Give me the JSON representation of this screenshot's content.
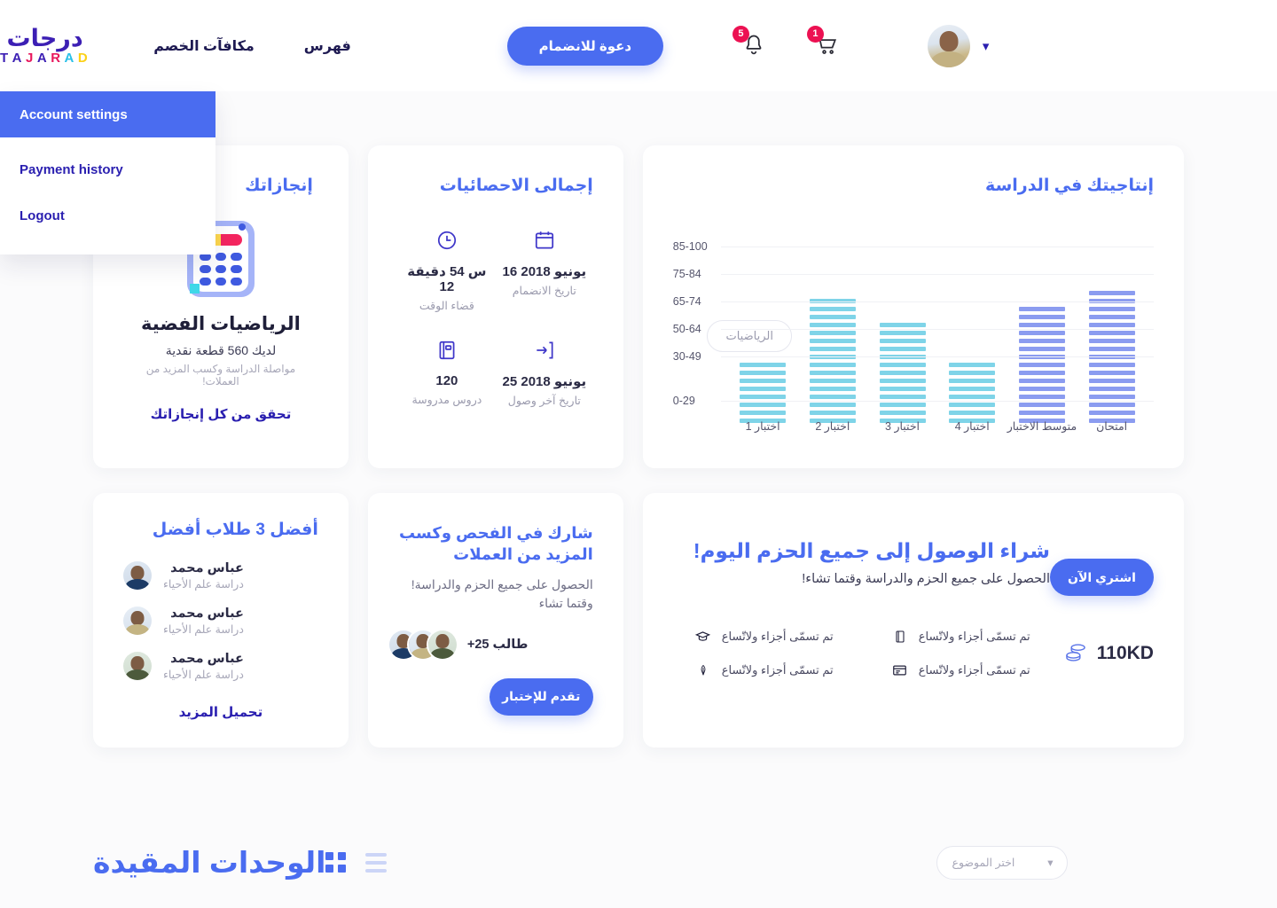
{
  "header": {
    "logo_ar": "درجات",
    "logo_latin": [
      "D",
      "A",
      "R",
      "A",
      "J",
      "A",
      "T"
    ],
    "nav": [
      {
        "label": "فهرس"
      },
      {
        "label": "مكافآت الخصم"
      }
    ],
    "cta_label": "دعوة للانضمام",
    "notifications_count": "5",
    "cart_count": "1"
  },
  "dropdown": {
    "items": [
      {
        "label": "Account settings",
        "active": true
      },
      {
        "label": "Payment history",
        "active": false
      },
      {
        "label": "Logout",
        "active": false
      }
    ]
  },
  "achievements": {
    "title": "إنجازاتك",
    "badge_name": "الرياضيات الفضية",
    "coins_text": "لديك 560 قطعة نقدية",
    "hint": "مواصلة الدراسة وكسب المزيد من العملات!",
    "link": "تحقق من كل إنجازاتك"
  },
  "stats": {
    "title": "إجمالى الاحصائيات",
    "items": [
      {
        "icon": "calendar-icon",
        "value": "يونيو 2018 16",
        "label": "تاريخ الانضمام"
      },
      {
        "icon": "clock-icon",
        "value": "س 54 دقيقة 12",
        "label": "قضاء الوقت"
      },
      {
        "icon": "login-arrow-icon",
        "value": "يونيو 2018 25",
        "label": "تاريخ آخر وصول"
      },
      {
        "icon": "book-icon",
        "value": "120",
        "label": "دروس مدروسة"
      }
    ]
  },
  "chart_card": {
    "title": "إنتاجيتك في الدراسة",
    "filter_chip": "الرياضيات"
  },
  "chart_data": {
    "type": "bar",
    "title": "إنتاجيتك في الدراسة",
    "categories": [
      "اختبار 1",
      "اختبار 2",
      "اختبار 3",
      "اختبار 4",
      "متوسط الاختبار",
      "امتحان"
    ],
    "values": [
      35,
      72,
      58,
      37,
      70,
      78
    ],
    "colors": [
      "#7fd4e8",
      "#7fd4e8",
      "#7fd4e8",
      "#7fd4e8",
      "#8b9cf0",
      "#8b9cf0"
    ],
    "ytick_labels": [
      "0-29",
      "30-49",
      "50-64",
      "65-74",
      "75-84",
      "85-100"
    ],
    "ytick_positions": [
      8,
      41,
      61,
      81,
      101,
      121
    ],
    "ylim": [
      0,
      100
    ],
    "xlabel": "",
    "ylabel": "",
    "grid": true,
    "legend": "none",
    "style": "striped-bars"
  },
  "top_students": {
    "title": "أفضل 3 طلاب أفضل",
    "students": [
      {
        "name": "عباس محمد",
        "desc": "دراسة علم الأحياء"
      },
      {
        "name": "عباس محمد",
        "desc": "دراسة علم الأحياء"
      },
      {
        "name": "عباس محمد",
        "desc": "دراسة علم الأحياء"
      }
    ],
    "link": "تحميل المزيد"
  },
  "exam_promo": {
    "title": "شارك في الفحص وكسب المزيد من العملات",
    "subtitle": "الحصول على جميع الحزم والدراسة! وقتما تشاء",
    "students_count": "طالب 25+",
    "button": "تقدم للإختبار"
  },
  "buy_card": {
    "title": "شراء الوصول إلى جميع الحزم اليوم!",
    "subtitle": "الحصول على جميع الحزم والدراسة وقتما تشاء!",
    "button": "اشتري الآن",
    "price": "110KD",
    "features": [
      {
        "icon": "book-icon",
        "text": "تم تسمّى أجزاء ولاتّساع"
      },
      {
        "icon": "graduation-cap-icon",
        "text": "تم تسمّى أجزاء ولاتّساع"
      },
      {
        "icon": "card-icon",
        "text": "تم تسمّى أجزاء ولاتّساع"
      },
      {
        "icon": "feather-icon",
        "text": "تم تسمّى أجزاء ولاتّساع"
      }
    ]
  },
  "bottom": {
    "title": "الوحدات المقيدة",
    "select_placeholder": "اختر الموضوع",
    "grid_view": "grid-view-icon",
    "list_view": "list-view-icon"
  },
  "colors": {
    "primary": "#4a6cf0",
    "deep": "#2a1fb0",
    "badge": "#ec1152",
    "bar_blue": "#8b9cf0",
    "bar_cyan": "#7fd4e8",
    "bg": "#fbfbfc"
  }
}
